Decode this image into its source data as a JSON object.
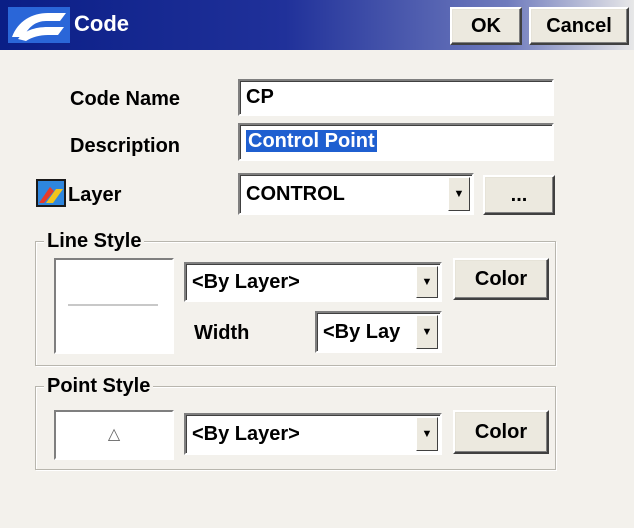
{
  "window": {
    "title": "Code",
    "ok_label": "OK",
    "cancel_label": "Cancel"
  },
  "form": {
    "code_name_label": "Code Name",
    "code_name_value": "CP",
    "description_label": "Description",
    "description_value": "Control Point",
    "layer_label": "Layer",
    "layer_value": "CONTROL",
    "layer_browse_label": "..."
  },
  "line_style": {
    "title": "Line Style",
    "style_value": "<By Layer>",
    "color_label": "Color",
    "width_label": "Width",
    "width_value": "<By Lay"
  },
  "point_style": {
    "title": "Point Style",
    "preview_symbol": "△",
    "style_value": "<By Layer>",
    "color_label": "Color"
  },
  "colors": {
    "title_bar_start": "#0a1e86",
    "selection": "#1f5fd0",
    "dialog_bg": "#f3f1ec"
  },
  "icons": {
    "title": "app-logo-icon",
    "layer": "layer-icon",
    "dropdown": "chevron-down-icon"
  }
}
